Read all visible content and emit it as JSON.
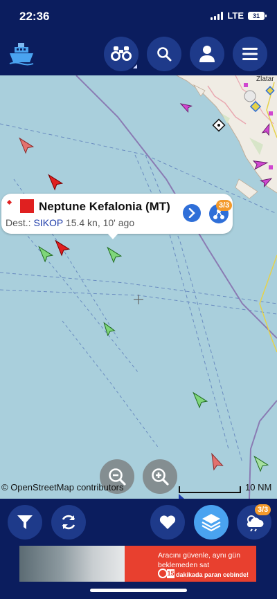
{
  "status_bar": {
    "time": "22:36",
    "network": "LTE",
    "battery": "31"
  },
  "toolbar": {
    "buttons": [
      "binoculars-icon",
      "search-icon",
      "user-icon",
      "menu-icon"
    ]
  },
  "map": {
    "city_label": "Zlatar",
    "attribution": "© OpenStreetMap contributors",
    "scale_label": "10 NM"
  },
  "popup": {
    "vessel_name": "Neptune Kefalonia (MT)",
    "dest_label": "Dest.:",
    "dest_value": "SIKOP",
    "speed_time": "15.4 kn, 10' ago",
    "badge": "3/3"
  },
  "bottom_bar": {
    "buttons": [
      "filter-icon",
      "refresh-icon",
      "heart-icon",
      "layers-icon",
      "weather-icon"
    ],
    "weather_badge": "3/3"
  },
  "ad": {
    "line1": "Aracını güvenle, aynı gün",
    "line2": "beklemeden sat",
    "timer_number": "15",
    "line3": "dakikada paran cebinde!"
  },
  "colors": {
    "navy": "#0b1d5e",
    "button": "#1e3a8a",
    "accent_blue": "#2f6fd8",
    "active_blue": "#4aa3f0",
    "badge_orange": "#f39a2b",
    "sea": "#a9cfdc",
    "tanker_red": "#e02020",
    "cargo_green": "#7fd67a"
  }
}
